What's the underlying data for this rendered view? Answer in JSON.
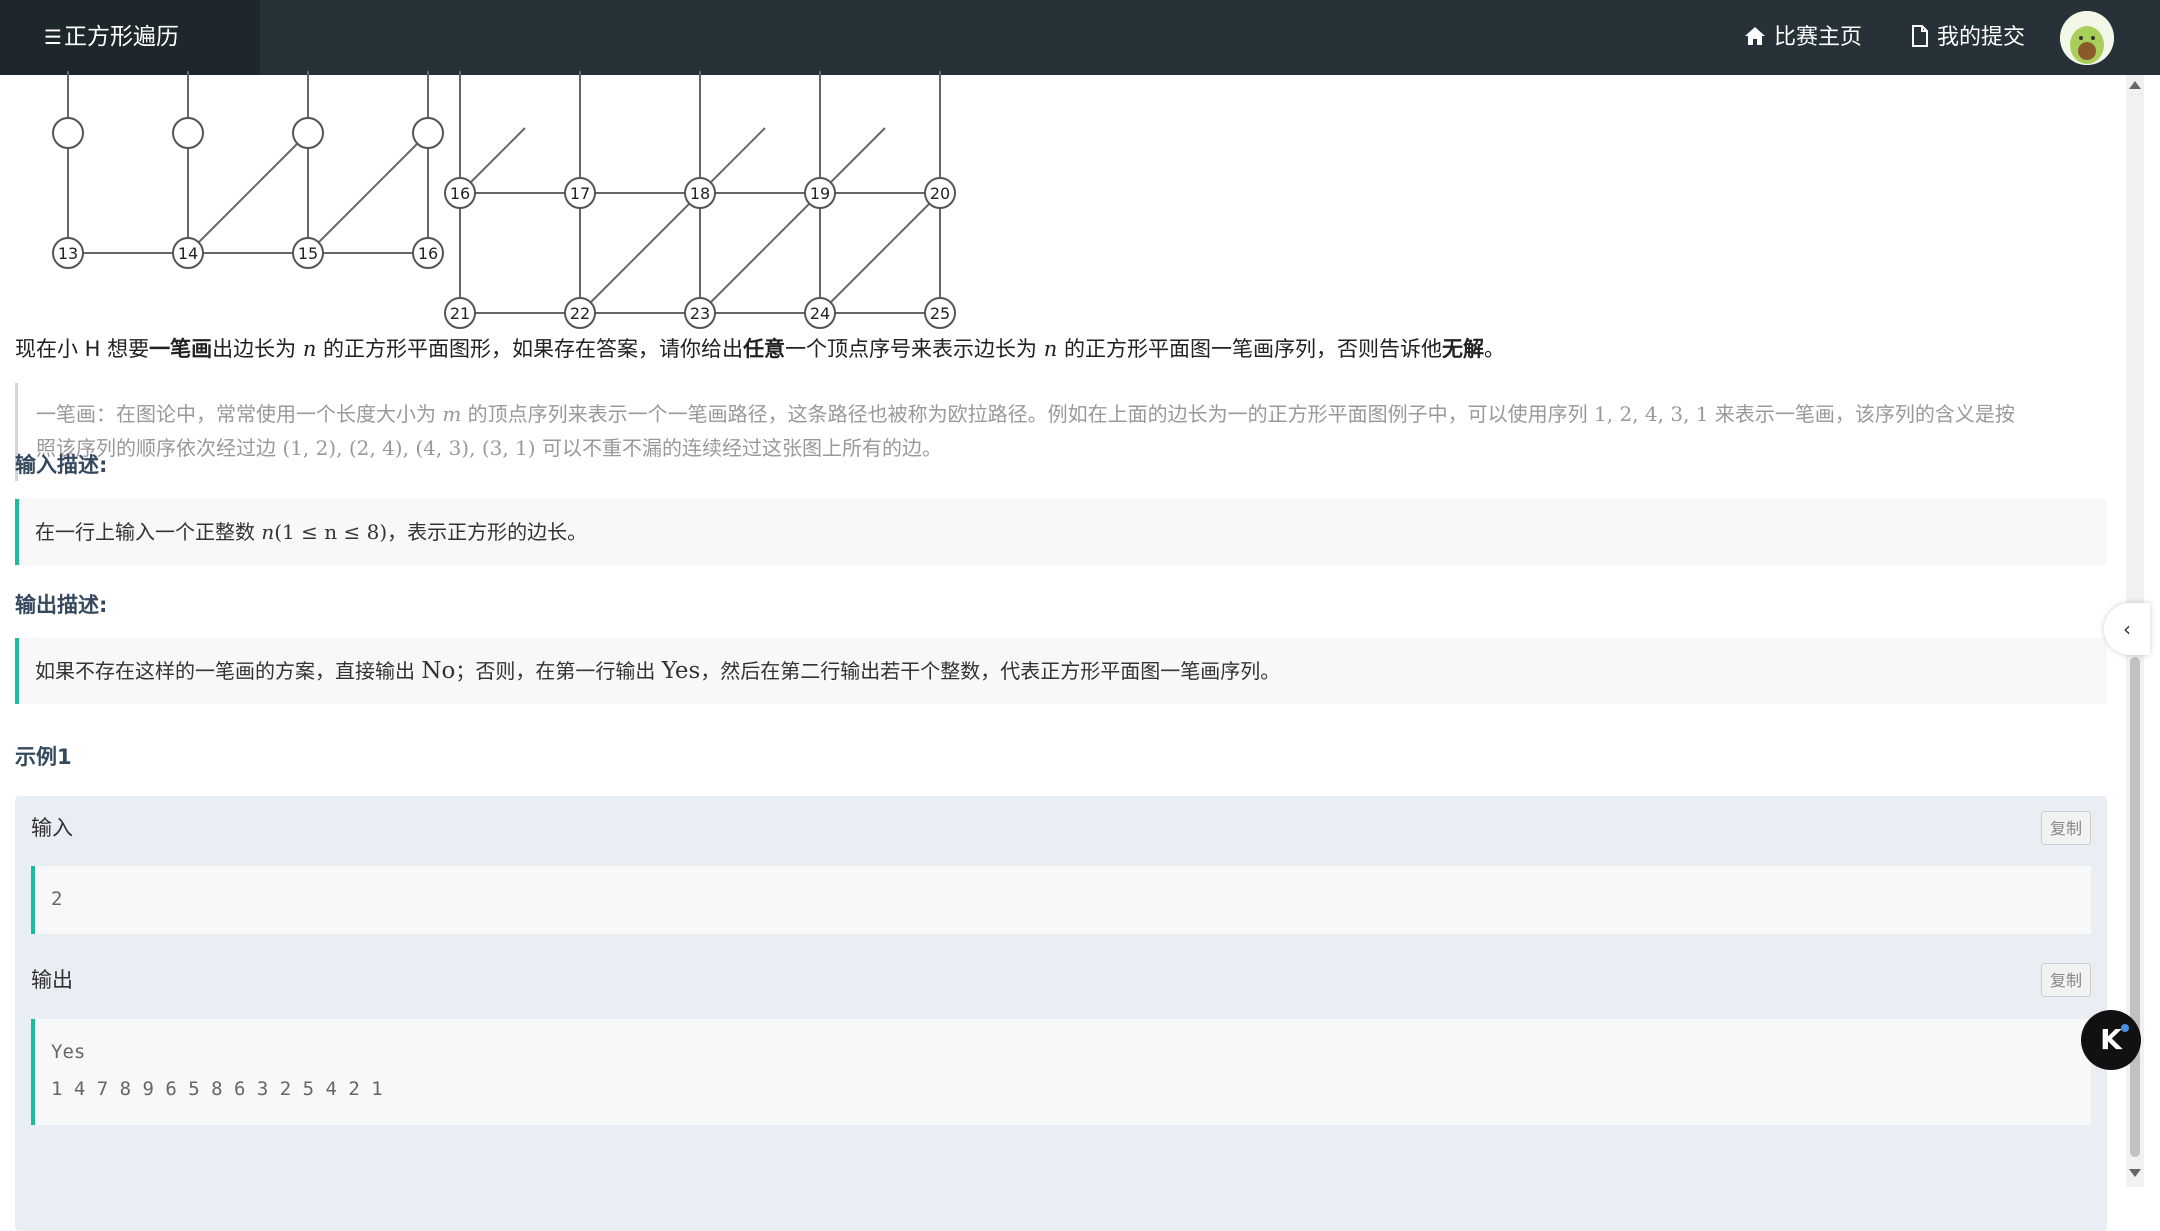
{
  "header": {
    "title": "正方形遍历",
    "nav": {
      "home": "比赛主页",
      "submissions": "我的提交"
    }
  },
  "graph": {
    "left_labels": [
      "13",
      "14",
      "15",
      "16"
    ],
    "right_labels": [
      "16",
      "17",
      "18",
      "19",
      "20",
      "21",
      "22",
      "23",
      "24",
      "25"
    ]
  },
  "problem": {
    "intro": {
      "p1": "现在小 H 想要",
      "b1": "一笔画",
      "p2": "出边长为 ",
      "n1": "n",
      "p3": " 的正方形平面图形，如果存在答案，请你给出",
      "b2": "任意",
      "p4": "一个顶点序号来表示边长为 ",
      "n2": "n",
      "p5": " 的正方形平面图一笔画序列，否则告诉他",
      "b3": "无解",
      "p6": "。"
    },
    "note": {
      "l1a": "一笔画：在图论中，常常使用一个长度大小为 ",
      "l1m": "m",
      "l1b": " 的顶点序列来表示一个一笔画路径，这条路径也被称为欧拉路径。例如在上面的边长为一的正方形平面图例子中，可以使用序列 ",
      "l1seq": "1, 2, 4, 3, 1",
      "l1c": " 来表示一笔画，该序列的含义是按",
      "l2a": "照该序列的顺序依次经过边 ",
      "l2edges": "(1, 2), (2, 4), (4, 3), (3, 1)",
      "l2b": " 可以不重不漏的连续经过这张图上所有的边。"
    },
    "input_title": "输入描述:",
    "input_desc": {
      "a": "在一行上输入一个正整数 ",
      "n": "n",
      "math": "(1 ≤ n ≤ 8)",
      "b": "，表示正方形的边长。"
    },
    "output_title": "输出描述:",
    "output_desc": {
      "a": "如果不存在这样的一笔画的方案，直接输出 ",
      "no": "No",
      "b": "；否则，在第一行输出 ",
      "yes": "Yes",
      "c": "，然后在第二行输出若干个整数，代表正方形平面图一笔画序列。"
    }
  },
  "example": {
    "title": "示例1",
    "input_label": "输入",
    "output_label": "输出",
    "copy_label": "复制",
    "input_lines": [
      "2"
    ],
    "output_lines": [
      "Yes",
      "1 4 7 8 9 6 5 8 6 3 2 5 4 2 1"
    ]
  },
  "side": {
    "toggle": "‹",
    "helper": "K"
  },
  "colors": {
    "topbar": "#263238",
    "accent": "#1abc9c",
    "example_bg": "#e9eef5"
  }
}
